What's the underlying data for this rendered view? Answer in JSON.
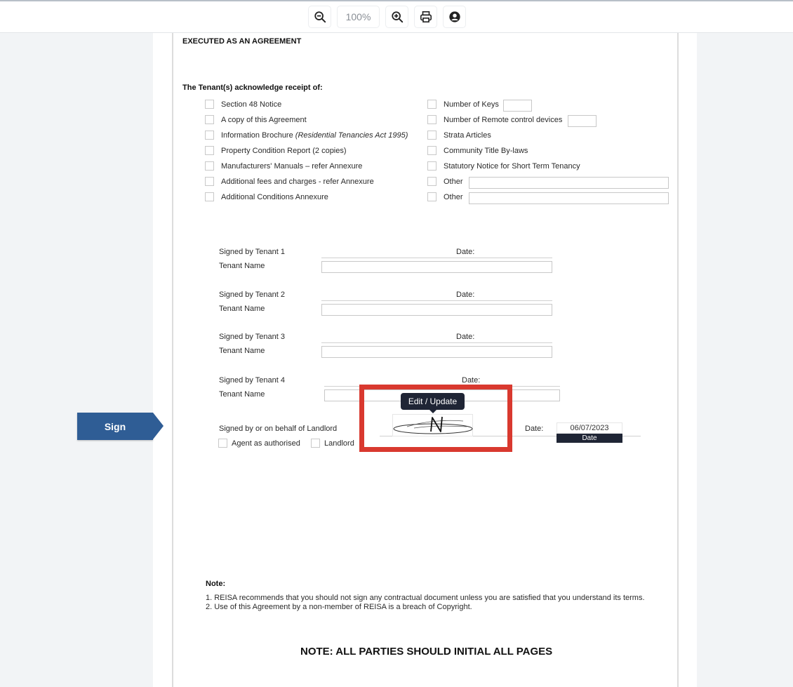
{
  "toolbar": {
    "zoom_out": "zoom-out",
    "zoom_level": "100%",
    "zoom_in": "zoom-in",
    "print": "print",
    "account": "account"
  },
  "side": {
    "sign_label": "Sign"
  },
  "document": {
    "heading": "EXECUTED AS AN AGREEMENT",
    "ack_title": "The Tenant(s) acknowledge receipt of:",
    "left_items": [
      {
        "label": "Section 48 Notice",
        "italic": ""
      },
      {
        "label": "A copy of this Agreement",
        "italic": ""
      },
      {
        "label": "Information Brochure ",
        "italic": "(Residential Tenancies Act 1995)"
      },
      {
        "label": "Property Condition Report (2 copies)",
        "italic": ""
      },
      {
        "label": "Manufacturers' Manuals – refer Annexure",
        "italic": ""
      },
      {
        "label": "Additional fees and charges - refer Annexure",
        "italic": ""
      },
      {
        "label": "Additional Conditions Annexure",
        "italic": ""
      }
    ],
    "right_items": [
      {
        "label": "Number of Keys",
        "value": ""
      },
      {
        "label": "Number of Remote control devices",
        "value": ""
      },
      {
        "label": "Strata Articles"
      },
      {
        "label": "Community Title By-laws"
      },
      {
        "label": "Statutory Notice for Short Term Tenancy"
      },
      {
        "label": "Other",
        "value": ""
      },
      {
        "label": "Other",
        "value": ""
      }
    ],
    "tenants": [
      {
        "signed_label": "Signed by Tenant 1",
        "date_label": "Date:",
        "name_label": "Tenant Name",
        "name_value": ""
      },
      {
        "signed_label": "Signed by Tenant 2",
        "date_label": "Date:",
        "name_label": "Tenant Name",
        "name_value": ""
      },
      {
        "signed_label": "Signed by Tenant 3",
        "date_label": "Date:",
        "name_label": "Tenant Name",
        "name_value": ""
      },
      {
        "signed_label": "Signed by Tenant 4",
        "date_label": "Date:",
        "name_label": "Tenant Name",
        "name_value": ""
      }
    ],
    "landlord": {
      "signed_label": "Signed by or on behalf of Landlord",
      "agent_label": "Agent as authorised",
      "landlord_label": "Landlord",
      "date_label": "Date:",
      "date_value": "06/07/2023",
      "date_caption": "Date",
      "tooltip": "Edit / Update"
    },
    "note_title": "Note:",
    "notes": [
      "1. REISA recommends that you should not sign any contractual document unless you are satisfied that you understand its terms.",
      "2. Use of this Agreement by a non-member of REISA is a breach of Copyright."
    ],
    "footer_note": "NOTE: ALL PARTIES SHOULD INITIAL ALL PAGES"
  },
  "colors": {
    "sign_tab": "#2f5d95",
    "highlight": "#d9392f",
    "tooltip_bg": "#1f2535"
  }
}
